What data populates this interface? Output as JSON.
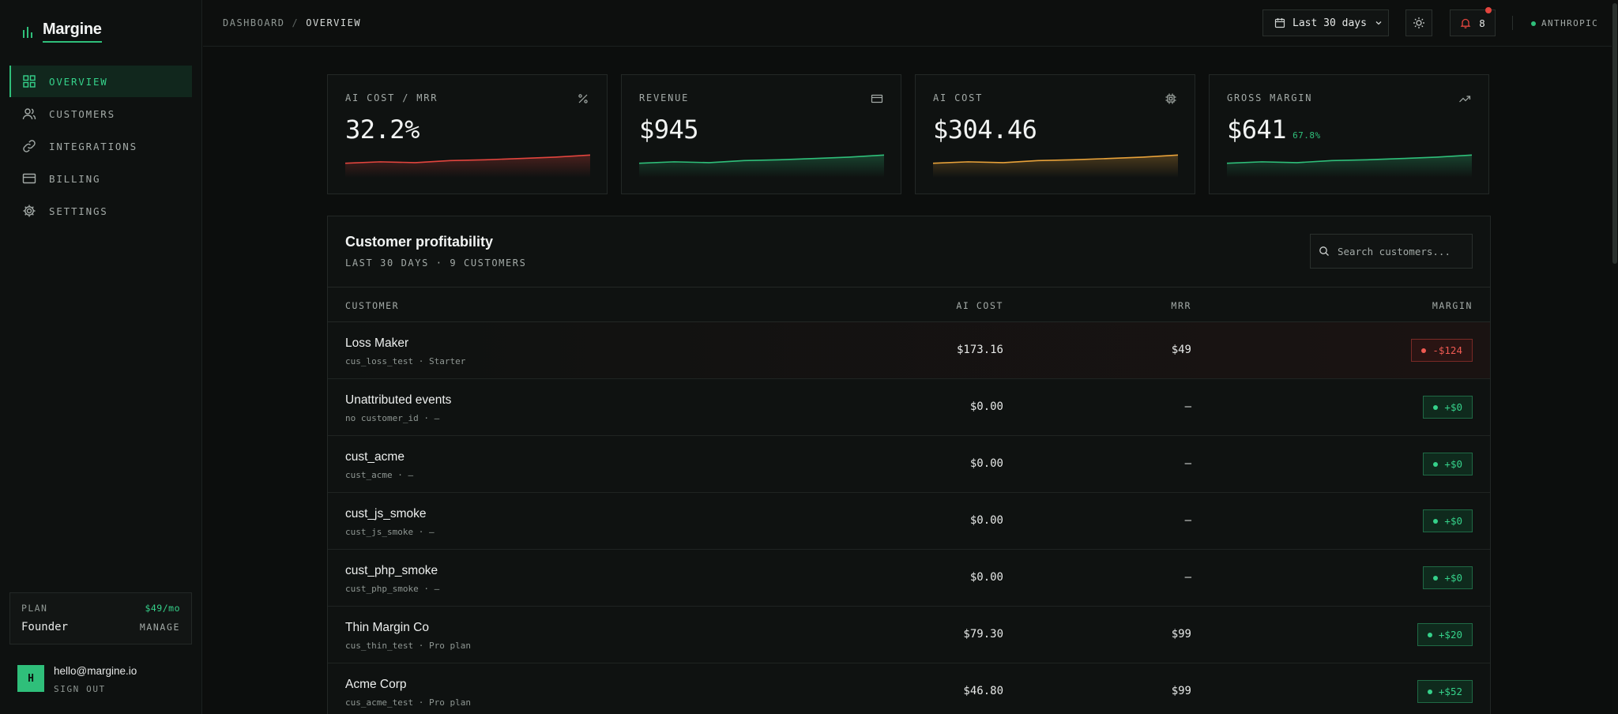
{
  "app": {
    "name": "Margine"
  },
  "sidebar": {
    "items": [
      {
        "label": "OVERVIEW",
        "icon": "grid-icon",
        "active": true
      },
      {
        "label": "CUSTOMERS",
        "icon": "users-icon",
        "active": false
      },
      {
        "label": "INTEGRATIONS",
        "icon": "link-icon",
        "active": false
      },
      {
        "label": "BILLING",
        "icon": "credit-card-icon",
        "active": false
      },
      {
        "label": "SETTINGS",
        "icon": "gear-icon",
        "active": false
      }
    ],
    "plan": {
      "label": "PLAN",
      "price": "$49/mo",
      "name": "Founder",
      "manage": "MANAGE"
    },
    "user": {
      "initial": "H",
      "email": "hello@margine.io",
      "signout": "SIGN OUT"
    }
  },
  "topbar": {
    "breadcrumb": [
      "DASHBOARD",
      "/",
      "OVERVIEW"
    ],
    "range": "Last 30 days",
    "notifications": "8",
    "provider": "ANTHROPIC"
  },
  "kpis": [
    {
      "label": "AI COST / MRR",
      "value": "32.2%",
      "sub": "",
      "icon": "percent-icon",
      "color": "#e2453e",
      "trend": [
        0.55,
        0.62,
        0.58,
        0.68,
        0.72,
        0.78,
        0.85,
        0.95
      ]
    },
    {
      "label": "REVENUE",
      "value": "$945",
      "sub": "",
      "icon": "card-icon",
      "color": "#2fbf7a",
      "trend": [
        0.55,
        0.62,
        0.58,
        0.68,
        0.72,
        0.78,
        0.85,
        0.95
      ]
    },
    {
      "label": "AI COST",
      "value": "$304.46",
      "sub": "",
      "icon": "chip-icon",
      "color": "#e8a23a",
      "trend": [
        0.55,
        0.62,
        0.58,
        0.68,
        0.72,
        0.78,
        0.85,
        0.95
      ]
    },
    {
      "label": "GROSS MARGIN",
      "value": "$641",
      "sub": "67.8%",
      "icon": "trending-up-icon",
      "color": "#2fbf7a",
      "trend": [
        0.55,
        0.62,
        0.58,
        0.68,
        0.72,
        0.78,
        0.85,
        0.95
      ]
    }
  ],
  "table": {
    "title": "Customer profitability",
    "subtitle": "LAST 30 DAYS · 9 CUSTOMERS",
    "search_placeholder": "Search customers...",
    "columns": [
      "CUSTOMER",
      "AI COST",
      "MRR",
      "MARGIN"
    ],
    "rows": [
      {
        "name": "Loss Maker",
        "meta": "cus_loss_test · Starter",
        "ai_cost": "$173.16",
        "mrr": "$49",
        "margin": "-$124",
        "status": "neg"
      },
      {
        "name": "Unattributed events",
        "meta": "no customer_id · —",
        "ai_cost": "$0.00",
        "mrr": "—",
        "margin": "+$0",
        "status": "pos"
      },
      {
        "name": "cust_acme",
        "meta": "cust_acme · —",
        "ai_cost": "$0.00",
        "mrr": "—",
        "margin": "+$0",
        "status": "pos"
      },
      {
        "name": "cust_js_smoke",
        "meta": "cust_js_smoke · —",
        "ai_cost": "$0.00",
        "mrr": "—",
        "margin": "+$0",
        "status": "pos"
      },
      {
        "name": "cust_php_smoke",
        "meta": "cust_php_smoke · —",
        "ai_cost": "$0.00",
        "mrr": "—",
        "margin": "+$0",
        "status": "pos"
      },
      {
        "name": "Thin Margin Co",
        "meta": "cus_thin_test · Pro plan",
        "ai_cost": "$79.30",
        "mrr": "$99",
        "margin": "+$20",
        "status": "pos"
      },
      {
        "name": "Acme Corp",
        "meta": "cus_acme_test · Pro plan",
        "ai_cost": "$46.80",
        "mrr": "$99",
        "margin": "+$52",
        "status": "pos"
      }
    ]
  }
}
